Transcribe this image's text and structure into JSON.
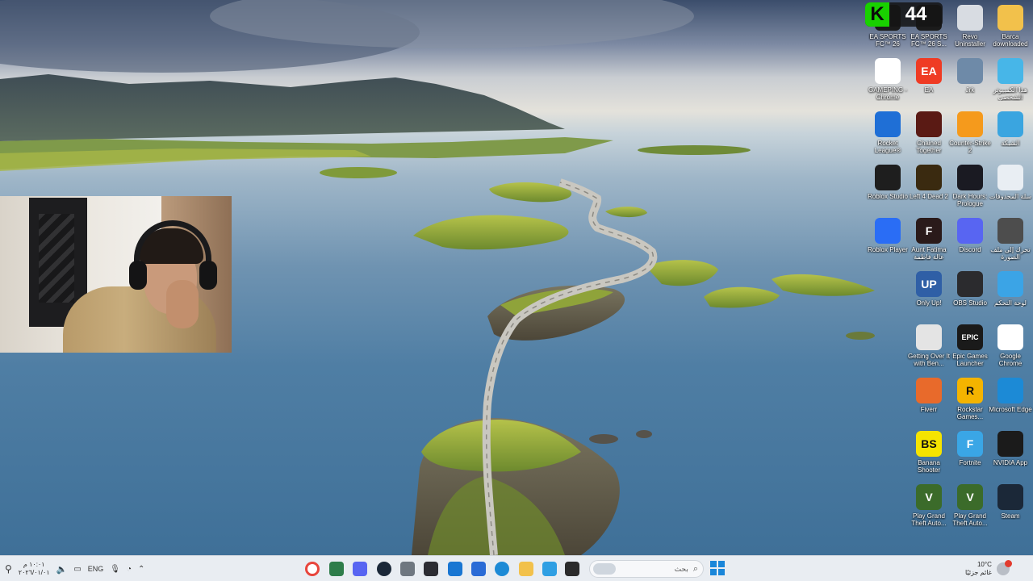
{
  "overlay_badge": {
    "letter": "K",
    "value": "44"
  },
  "desktop_icons": [
    {
      "label": "EA SPORTS FC™ 26",
      "icon": "ea-sports-fc-icon",
      "color": "#1b1b1b",
      "glyph": ""
    },
    {
      "label": "EA SPORTS FC™ 26 S...",
      "icon": "ea-sports-fc-showcase-icon",
      "color": "#1b1b1b",
      "glyph": ""
    },
    {
      "label": "Revo Uninstaller",
      "icon": "revo-uninstaller-icon",
      "color": "#d8dce2",
      "glyph": ""
    },
    {
      "label": "Barca downloaded",
      "icon": "folder-icon",
      "color": "#f2c14b",
      "glyph": ""
    },
    {
      "label": "GAMEPING - Chrome",
      "icon": "chrome-icon",
      "color": "#ffffff",
      "glyph": ""
    },
    {
      "label": "EA",
      "icon": "ea-app-icon",
      "color": "#ef3b24",
      "glyph": "EA"
    },
    {
      "label": "Jrk",
      "icon": "pubg-icon",
      "color": "#6e8aa8",
      "glyph": ""
    },
    {
      "label": "هذا الكمبيوتر الشخصي",
      "icon": "this-pc-icon",
      "color": "#47b6e8",
      "glyph": ""
    },
    {
      "label": "Rocket League®",
      "icon": "rocket-league-icon",
      "color": "#1f6fd6",
      "glyph": ""
    },
    {
      "label": "Chained Together",
      "icon": "chained-together-icon",
      "color": "#5a1a14",
      "glyph": ""
    },
    {
      "label": "Counter-Strike 2",
      "icon": "counter-strike-icon",
      "color": "#f59a1c",
      "glyph": ""
    },
    {
      "label": "الشبكة",
      "icon": "network-icon",
      "color": "#3aa5e0",
      "glyph": ""
    },
    {
      "label": "Roblox Studio",
      "icon": "roblox-studio-icon",
      "color": "#1e1e1e",
      "glyph": ""
    },
    {
      "label": "Left 4 Dead 2",
      "icon": "left4dead-icon",
      "color": "#3a2a10",
      "glyph": ""
    },
    {
      "label": "Dark Hours: Prologue",
      "icon": "dark-hours-icon",
      "color": "#1a1a22",
      "glyph": ""
    },
    {
      "label": "سلة المحذوفات",
      "icon": "recycle-bin-icon",
      "color": "#e9eef3",
      "glyph": ""
    },
    {
      "label": "Roblox Player",
      "icon": "roblox-player-icon",
      "color": "#2a6df5",
      "glyph": ""
    },
    {
      "label": "Aunt Fatima عالة فاطمة",
      "icon": "aunt-fatima-icon",
      "color": "#2a1a1a",
      "glyph": "F"
    },
    {
      "label": "Discord",
      "icon": "discord-icon",
      "color": "#5865f2",
      "glyph": ""
    },
    {
      "label": "تحرك إلى ملف الصورة",
      "icon": "shortcut-icon",
      "color": "#4d4d4d",
      "glyph": ""
    },
    {
      "label": "Only Up!",
      "icon": "only-up-icon",
      "color": "#2f5fa6",
      "glyph": "UP"
    },
    {
      "label": "OBS Studio",
      "icon": "obs-studio-icon",
      "color": "#2b2b2e",
      "glyph": ""
    },
    {
      "label": "لوحة التحكم",
      "icon": "control-panel-icon",
      "color": "#3ba4e6",
      "glyph": ""
    },
    {
      "label": "Getting Over It with Ben...",
      "icon": "getting-over-it-icon",
      "color": "#e4e4e4",
      "glyph": ""
    },
    {
      "label": "Epic Games Launcher",
      "icon": "epic-games-icon",
      "color": "#1a1a1a",
      "glyph": "EPIC"
    },
    {
      "label": "Google Chrome",
      "icon": "chrome-icon",
      "color": "#ffffff",
      "glyph": ""
    },
    {
      "label": "Fiverr",
      "icon": "fiverr-icon",
      "color": "#e86a2b",
      "glyph": ""
    },
    {
      "label": "Rockstar Games...",
      "icon": "rockstar-icon",
      "color": "#f4b400",
      "glyph": "R"
    },
    {
      "label": "Microsoft Edge",
      "icon": "edge-icon",
      "color": "#1c8ad6",
      "glyph": ""
    },
    {
      "label": "Banana Shooter",
      "icon": "banana-shooter-icon",
      "color": "#f5e400",
      "glyph": "BS"
    },
    {
      "label": "Fortnite",
      "icon": "fortnite-icon",
      "color": "#3aa6e6",
      "glyph": "F"
    },
    {
      "label": "NVIDIA App",
      "icon": "nvidia-icon",
      "color": "#1b1b1b",
      "glyph": ""
    },
    {
      "label": "Play Grand Theft Auto...",
      "icon": "gta-icon",
      "color": "#3b6b2a",
      "glyph": "V"
    },
    {
      "label": "Play Grand Theft Auto...",
      "icon": "gta-icon",
      "color": "#3b6b2a",
      "glyph": "V"
    },
    {
      "label": "Steam",
      "icon": "steam-icon",
      "color": "#1b2838",
      "glyph": ""
    }
  ],
  "taskbar": {
    "language": "ENG",
    "clock_time": "١٠:٠١ م",
    "clock_date": "٢٠٢٦/٠١/٠١",
    "search_placeholder": "بحث",
    "weather_temp": "10°C",
    "weather_desc": "غائم جزئيًا",
    "apps": [
      {
        "name": "chrome",
        "icon": "chrome-icon",
        "color": "#ffffff"
      },
      {
        "name": "xbox-gamebar",
        "icon": "gamebar-icon",
        "color": "#2e7d4a"
      },
      {
        "name": "discord",
        "icon": "discord-icon",
        "color": "#5865f2"
      },
      {
        "name": "steam",
        "icon": "steam-icon",
        "color": "#1b2838"
      },
      {
        "name": "settings",
        "icon": "gear-icon",
        "color": "#6f7780"
      },
      {
        "name": "controller",
        "icon": "controller-icon",
        "color": "#2d2d33"
      },
      {
        "name": "mail",
        "icon": "mail-icon",
        "color": "#1976d2"
      },
      {
        "name": "store",
        "icon": "store-icon",
        "color": "#2a6bd6"
      },
      {
        "name": "edge",
        "icon": "edge-icon",
        "color": "#1c8ad6"
      },
      {
        "name": "file-explorer",
        "icon": "folder-icon",
        "color": "#f2c14b"
      },
      {
        "name": "photos",
        "icon": "photos-icon",
        "color": "#2f9fe3"
      },
      {
        "name": "terminal",
        "icon": "terminal-icon",
        "color": "#2b2b2b"
      }
    ]
  }
}
